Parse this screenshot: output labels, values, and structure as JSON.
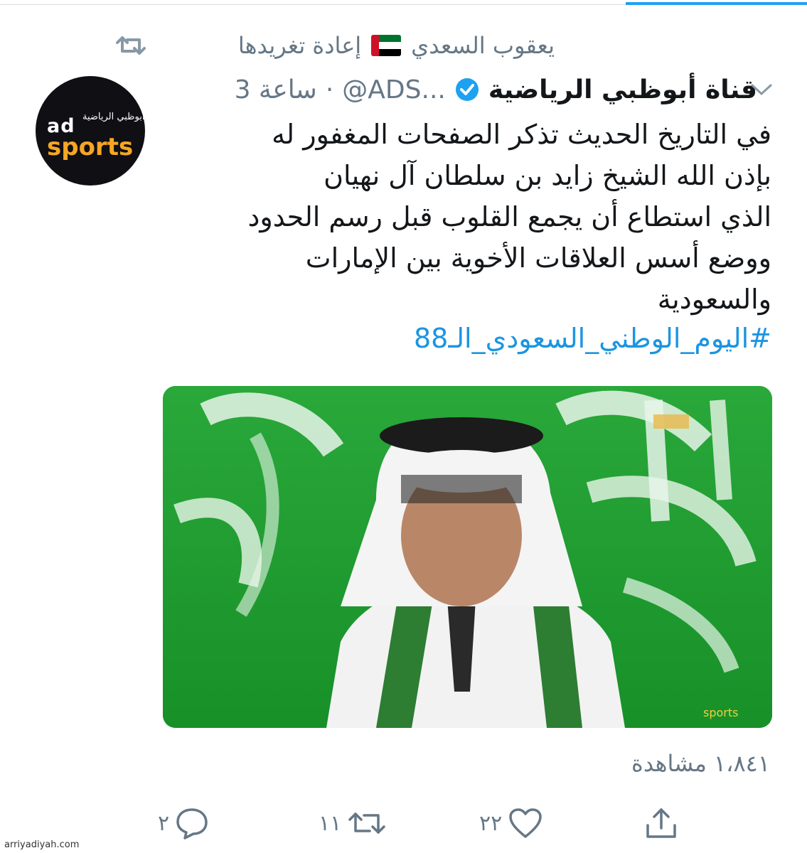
{
  "retweet_context": {
    "user": "يعقوب السعدي",
    "label": "إعادة تغريدها",
    "flag": "uae-flag"
  },
  "tweet": {
    "display_name": "قناة أبوظبي الرياضية",
    "handle": "@ADS...",
    "separator": "·",
    "time": "3 ساعة",
    "verified": true,
    "avatar": {
      "arabic": "أبوظبي الرياضية",
      "ad": "ad",
      "sports": "sports"
    },
    "body_lines": [
      "في التاريخ الحديث تذكر الصفحات المغفور له",
      "بإذن الله الشيخ زايد بن سلطان آل نهيان",
      "الذي استطاع أن يجمع القلوب قبل رسم الحدود",
      "ووضع أسس العلاقات الأخوية بين الإمارات",
      "والسعودية"
    ],
    "hashtag": "#اليوم_الوطني_السعودي_الـ88",
    "video_logo": "sports",
    "views_count": "١،٨٤١",
    "views_label": "مشاهدة"
  },
  "actions": {
    "reply_count": "٢",
    "retweet_count": "١١",
    "like_count": "٢٢"
  },
  "watermark": "arriyadiyah.com",
  "colors": {
    "accent": "#1da1f2",
    "link": "#1b95e0",
    "muted": "#657786",
    "text": "#14171a"
  }
}
